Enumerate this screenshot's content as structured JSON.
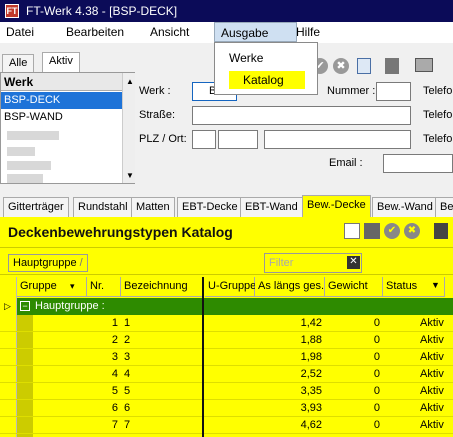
{
  "window": {
    "title": "FT-Werk 4.38 - [BSP-DECK]",
    "app_icon": "FT"
  },
  "menu": {
    "items": [
      "Datei",
      "Bearbeiten",
      "Ansicht",
      "Ausgabe",
      "Hilfe"
    ],
    "open": "Ausgabe",
    "dropdown": [
      "Werke",
      "Katalog"
    ]
  },
  "left_tabs": [
    "Alle",
    "Aktiv"
  ],
  "werk_list": {
    "header": "Werk",
    "rows": [
      "BSP-DECK",
      "BSP-WAND"
    ]
  },
  "form": {
    "werk_label": "Werk :",
    "werk_value": "BSP",
    "strasse_label": "Straße:",
    "plz_label": "PLZ / Ort:",
    "nummer_label": "Nummer :",
    "telefon_label": "Telefo",
    "email_label": "Email :"
  },
  "main_tabs": [
    "Gitterträger",
    "Rundstahl",
    "Matten",
    "EBT-Decke",
    "EBT-Wand",
    "Bew.-Decke",
    "Bew.-Wand",
    "Be"
  ],
  "active_tab": "Bew.-Decke",
  "panel": {
    "title": "Deckenbewehrungstypen Katalog",
    "group_chip": "Hauptgruppe",
    "filter_placeholder": "Filter"
  },
  "grid": {
    "headers": [
      "Gruppe",
      "Nr.",
      "Bezeichnung",
      "U-Gruppe",
      "As längs ges.",
      "Gewicht",
      "Status"
    ],
    "group_row": "Hauptgruppe :",
    "rows": [
      {
        "nr": "1",
        "bez": "1",
        "as": "1,42",
        "gew": "0",
        "status": "Aktiv"
      },
      {
        "nr": "2",
        "bez": "2",
        "as": "1,88",
        "gew": "0",
        "status": "Aktiv"
      },
      {
        "nr": "3",
        "bez": "3",
        "as": "1,98",
        "gew": "0",
        "status": "Aktiv"
      },
      {
        "nr": "4",
        "bez": "4",
        "as": "2,52",
        "gew": "0",
        "status": "Aktiv"
      },
      {
        "nr": "5",
        "bez": "5",
        "as": "3,35",
        "gew": "0",
        "status": "Aktiv"
      },
      {
        "nr": "6",
        "bez": "6",
        "as": "3,93",
        "gew": "0",
        "status": "Aktiv"
      },
      {
        "nr": "7",
        "bez": "7",
        "as": "4,62",
        "gew": "0",
        "status": "Aktiv"
      }
    ]
  },
  "colors": {
    "accent": "#ffff00",
    "title_bar": "#0b0b58",
    "group_row": "#2e8b00",
    "selection": "#1e73d8"
  }
}
